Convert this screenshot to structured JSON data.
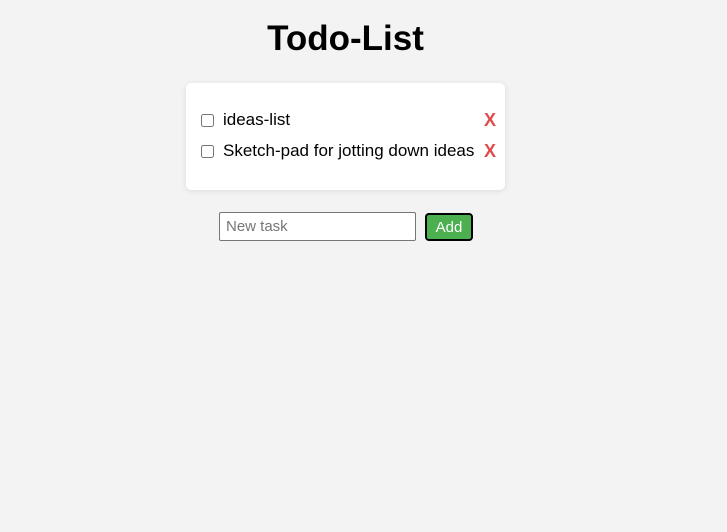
{
  "page": {
    "title": "Todo-List"
  },
  "todos": [
    {
      "text": "ideas-list",
      "done": false,
      "delete_label": "X"
    },
    {
      "text": "Sketch-pad for jotting down ideas",
      "done": false,
      "delete_label": "X"
    }
  ],
  "new_task": {
    "value": "",
    "placeholder": "New task",
    "add_label": "Add"
  },
  "colors": {
    "background": "#f3f3f3",
    "card": "#ffffff",
    "delete": "#e04b4b",
    "add_button": "#4caf50"
  }
}
